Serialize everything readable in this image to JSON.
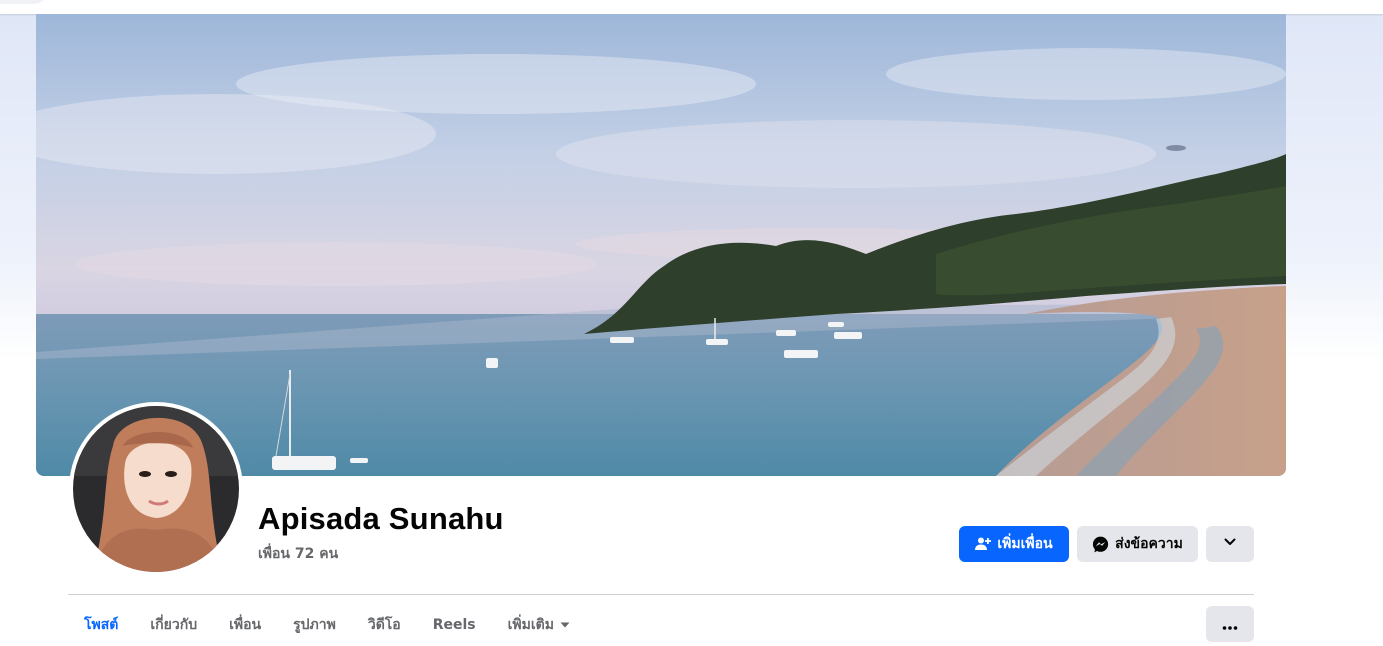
{
  "profile": {
    "name": "Apisada Sunahu",
    "friends_text": "เพื่อน 72 คน"
  },
  "actions": {
    "add_friend_label": "เพิ่มเพื่อน",
    "message_label": "ส่งข้อความ",
    "add_friend_icon": "person-add-icon",
    "message_icon": "messenger-icon",
    "dropdown_icon": "chevron-down-icon"
  },
  "tabs": [
    {
      "label": "โพสต์",
      "active": true
    },
    {
      "label": "เกี่ยวกับ",
      "active": false
    },
    {
      "label": "เพื่อน",
      "active": false
    },
    {
      "label": "รูปภาพ",
      "active": false
    },
    {
      "label": "วิดีโอ",
      "active": false
    },
    {
      "label": "Reels",
      "active": false
    },
    {
      "label": "เพิ่มเติม",
      "active": false
    }
  ],
  "colors": {
    "accent": "#0866ff",
    "secondary_button": "#e4e6eb",
    "text_primary": "#050505",
    "text_secondary": "#65676b"
  }
}
